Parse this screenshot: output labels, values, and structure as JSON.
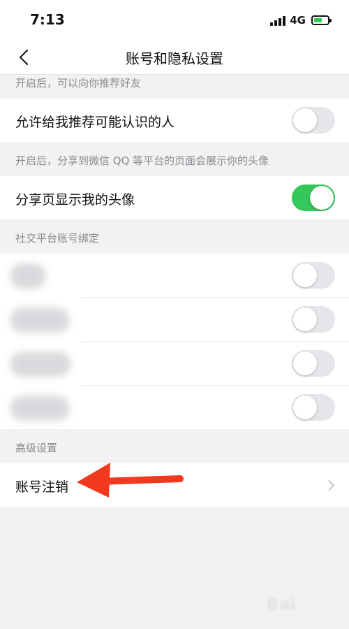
{
  "status_bar": {
    "time": "7:13",
    "network": "4G",
    "battery_level": 0.6,
    "signal_icon": "signal-bars-icon",
    "battery_icon": "battery-charging-icon"
  },
  "nav": {
    "title": "账号和隐私设置",
    "back_icon": "chevron-left-icon"
  },
  "sections": {
    "recommend_hint": "开启后，可以向你推荐好友",
    "avatar_hint": "开启后，分享到微信 QQ 等平台的页面会展示你的头像",
    "social_title": "社交平台账号绑定",
    "advanced_title": "高级设置"
  },
  "rows": {
    "recommend": {
      "label": "允许给我推荐可能认识的人",
      "enabled": false
    },
    "share_avatar": {
      "label": "分享页显示我的头像",
      "enabled": true
    },
    "social_accounts": [
      {
        "enabled": false
      },
      {
        "enabled": false
      },
      {
        "enabled": false
      },
      {
        "enabled": false
      }
    ],
    "account_cancel": {
      "label": "账号注销",
      "icon": "chevron-right-icon"
    }
  },
  "annotation": {
    "arrow_color": "#f0391f"
  },
  "colors": {
    "toggle_on": "#34c759",
    "toggle_off": "#e6e6ea"
  },
  "watermark": {
    "text": "B"
  }
}
